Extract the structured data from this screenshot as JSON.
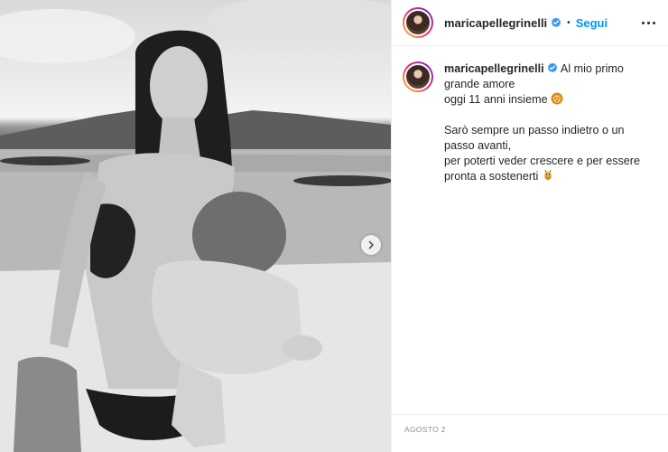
{
  "post": {
    "username": "maricapellegrinelli",
    "follow_label": "Segui",
    "separator": "•",
    "caption": {
      "line1": "Al mio primo",
      "line2": "grande amore",
      "line3": "oggi 11 anni insieme",
      "line3_emoji": "lion-emoji",
      "line4": "Sarò sempre un passo indietro o un",
      "line5": "passo avanti,",
      "line6": "per poterti veder crescere e per essere",
      "line7": "pronta a sostenerti",
      "line7_emoji": "giraffe-emoji"
    },
    "date": "AGOSTO 2"
  },
  "icons": {
    "verified": "verified-badge-icon",
    "more": "more-options-icon",
    "next": "carousel-next-icon"
  },
  "colors": {
    "accent": "#0095f6",
    "text": "#262626",
    "muted": "#8e8e8e"
  }
}
